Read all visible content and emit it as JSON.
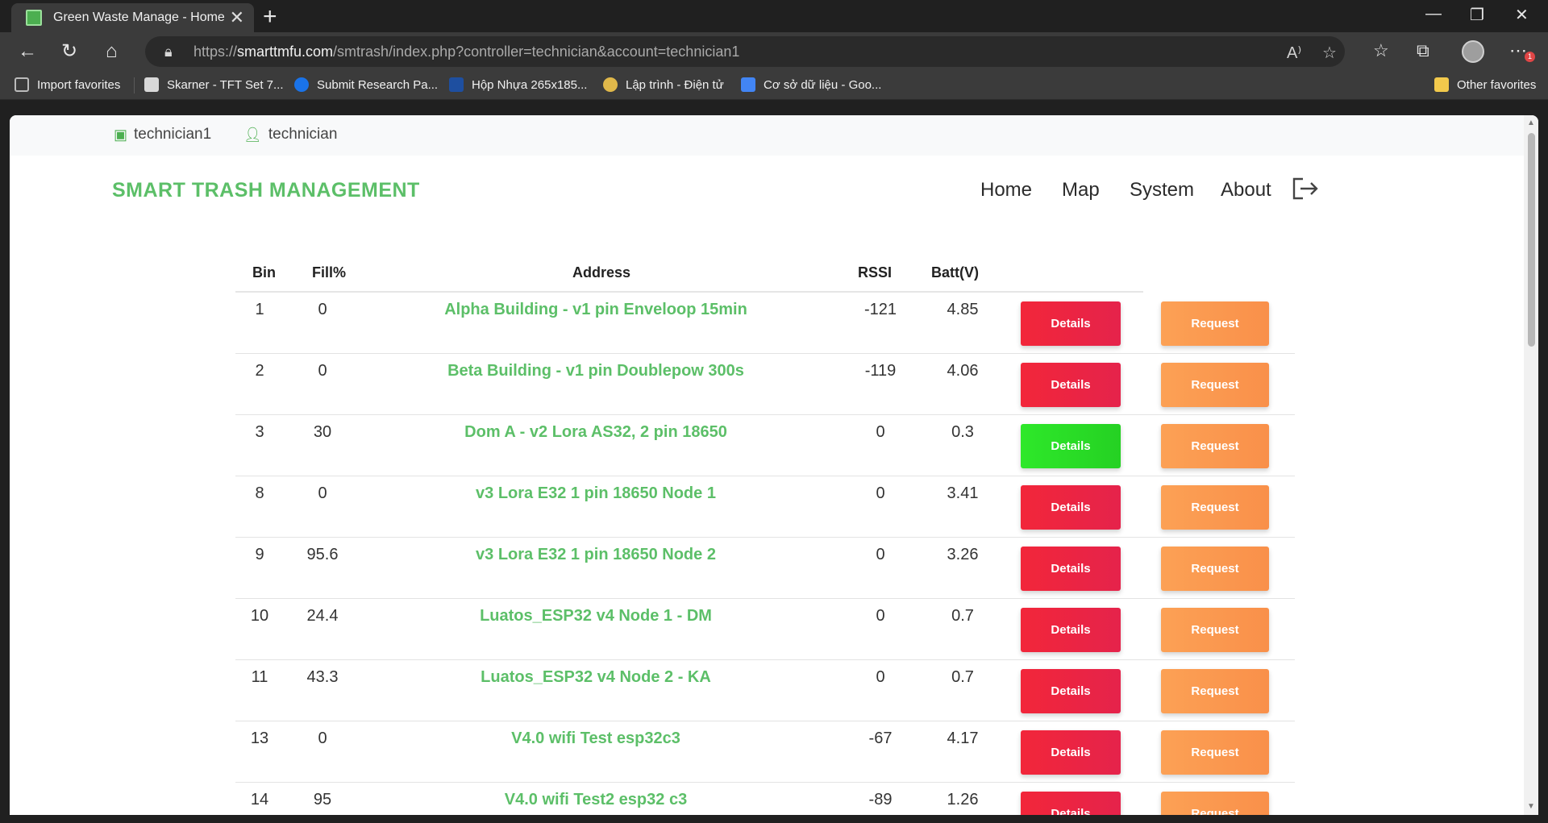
{
  "browser": {
    "tab_title": "Green Waste Manage - Home",
    "url_prefix": "https://",
    "url_domain": "smarttmfu.com",
    "url_path": "/smtrash/index.php?controller=technician&account=technician1",
    "bookmarks": [
      {
        "label": "Import favorites",
        "icon": "import-icon",
        "color": "#bbbbbb"
      },
      {
        "label": "Skarner - TFT Set 7...",
        "icon": "skarner-icon",
        "color": "#d8d8d8"
      },
      {
        "label": "Submit Research Pa...",
        "icon": "c-icon",
        "color": "#1a73e8"
      },
      {
        "label": "Hộp Nhựa 265x185...",
        "icon": "dx-icon",
        "color": "#1e4fa0"
      },
      {
        "label": "Lập trình - Điện tử",
        "icon": "pin-icon",
        "color": "#e0b84a"
      },
      {
        "label": "Cơ sở dữ liệu - Goo...",
        "icon": "docs-icon",
        "color": "#4285f4"
      }
    ],
    "other_favorites": "Other favorites",
    "badge": "1"
  },
  "header": {
    "account": "technician1",
    "role": "technician"
  },
  "brand": "SMART TRASH MANAGEMENT",
  "nav": {
    "home": "Home",
    "map": "Map",
    "system": "System",
    "about": "About"
  },
  "table": {
    "columns": [
      "Bin",
      "Fill%",
      "Address",
      "RSSI",
      "Batt(V)"
    ],
    "rows": [
      {
        "bin": "1",
        "fill": "0",
        "address": "Alpha Building - v1 pin Enveloop 15min",
        "rssi": "-121",
        "batt": "4.85",
        "details": "Details",
        "request": "Request",
        "status": "alert"
      },
      {
        "bin": "2",
        "fill": "0",
        "address": "Beta Building - v1 pin Doublepow 300s",
        "rssi": "-119",
        "batt": "4.06",
        "details": "Details",
        "request": "Request",
        "status": "alert"
      },
      {
        "bin": "3",
        "fill": "30",
        "address": "Dom A - v2 Lora AS32, 2 pin 18650",
        "rssi": "0",
        "batt": "0.3",
        "details": "Details",
        "request": "Request",
        "status": "ok"
      },
      {
        "bin": "8",
        "fill": "0",
        "address": "v3 Lora E32 1 pin 18650 Node 1",
        "rssi": "0",
        "batt": "3.41",
        "details": "Details",
        "request": "Request",
        "status": "alert"
      },
      {
        "bin": "9",
        "fill": "95.6",
        "address": "v3 Lora E32 1 pin 18650 Node 2",
        "rssi": "0",
        "batt": "3.26",
        "details": "Details",
        "request": "Request",
        "status": "alert"
      },
      {
        "bin": "10",
        "fill": "24.4",
        "address": "Luatos_ESP32 v4 Node 1 - DM",
        "rssi": "0",
        "batt": "0.7",
        "details": "Details",
        "request": "Request",
        "status": "alert"
      },
      {
        "bin": "11",
        "fill": "43.3",
        "address": "Luatos_ESP32 v4 Node 2 - KA",
        "rssi": "0",
        "batt": "0.7",
        "details": "Details",
        "request": "Request",
        "status": "alert"
      },
      {
        "bin": "13",
        "fill": "0",
        "address": "V4.0 wifi Test esp32c3",
        "rssi": "-67",
        "batt": "4.17",
        "details": "Details",
        "request": "Request",
        "status": "alert"
      },
      {
        "bin": "14",
        "fill": "95",
        "address": "V4.0 wifi Test2 esp32 c3",
        "rssi": "-89",
        "batt": "1.26",
        "details": "Details",
        "request": "Request",
        "status": "alert"
      }
    ]
  },
  "colors": {
    "brand_green": "#5cbf68",
    "details_red": "#f2263a",
    "details_green": "#2ee82a",
    "request_orange": "#fca155"
  }
}
